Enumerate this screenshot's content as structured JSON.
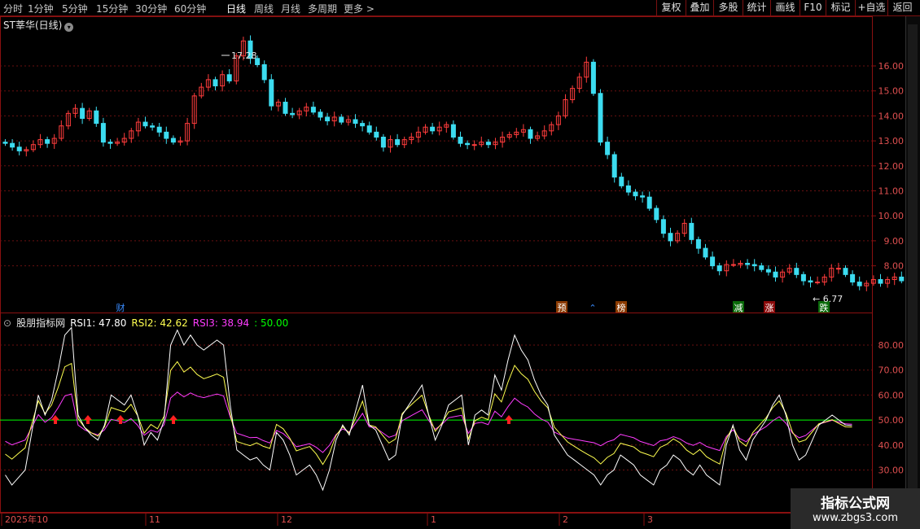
{
  "toolbar": {
    "periods": [
      "分时",
      "1分钟",
      "5分钟",
      "15分钟",
      "30分钟",
      "60分钟",
      "日线",
      "周线",
      "月线",
      "多周期",
      "更多 >"
    ],
    "active_period": "日线",
    "right_buttons": [
      "复权",
      "叠加",
      "多股",
      "统计",
      "画线",
      "F10",
      "标记",
      "+自选",
      "返回"
    ]
  },
  "stock": {
    "name": "ST莘华(日线)",
    "high_label": "17.28",
    "low_label": "6.77"
  },
  "price_axis": [
    "16.00",
    "15.00",
    "14.00",
    "13.00",
    "12.00",
    "11.00",
    "10.00",
    "9.00",
    "8.00"
  ],
  "markers": [
    {
      "text": "财",
      "color": "#3a8cff"
    },
    {
      "text": "预",
      "color": "#ffffff",
      "bg": "#8a3a00"
    },
    {
      "text": "榜",
      "color": "#ffffff",
      "bg": "#8a3a00"
    },
    {
      "text": "减",
      "color": "#ffffff",
      "bg": "#0a6a0a"
    },
    {
      "text": "涨",
      "color": "#ffffff",
      "bg": "#8a0a0a"
    },
    {
      "text": "跌",
      "color": "#ffffff",
      "bg": "#0a6a0a"
    }
  ],
  "indicator": {
    "name": "股朋指标网",
    "rsi1": "RSI1: 47.80",
    "rsi2": "RSI2: 42.62",
    "rsi3": "RSI3: 38.94",
    "level": ": 50.00",
    "axis": [
      "80.00",
      "70.00",
      "60.00",
      "50.00",
      "40.00",
      "30.00"
    ]
  },
  "time_axis": [
    "2025年10",
    "11",
    "12",
    "1",
    "2",
    "3"
  ],
  "watermark": {
    "title": "指标公式网",
    "url": "www.zbgs3.com"
  },
  "colors": {
    "up": "#ff3c3c",
    "down": "#3cdcf0",
    "rsi1": "#ffffff",
    "rsi2": "#ffff50",
    "rsi3": "#ff3cff",
    "level": "#00ff00",
    "frame": "#8a1010",
    "grid": "#6a1010",
    "signal": "#ff2020"
  }
}
